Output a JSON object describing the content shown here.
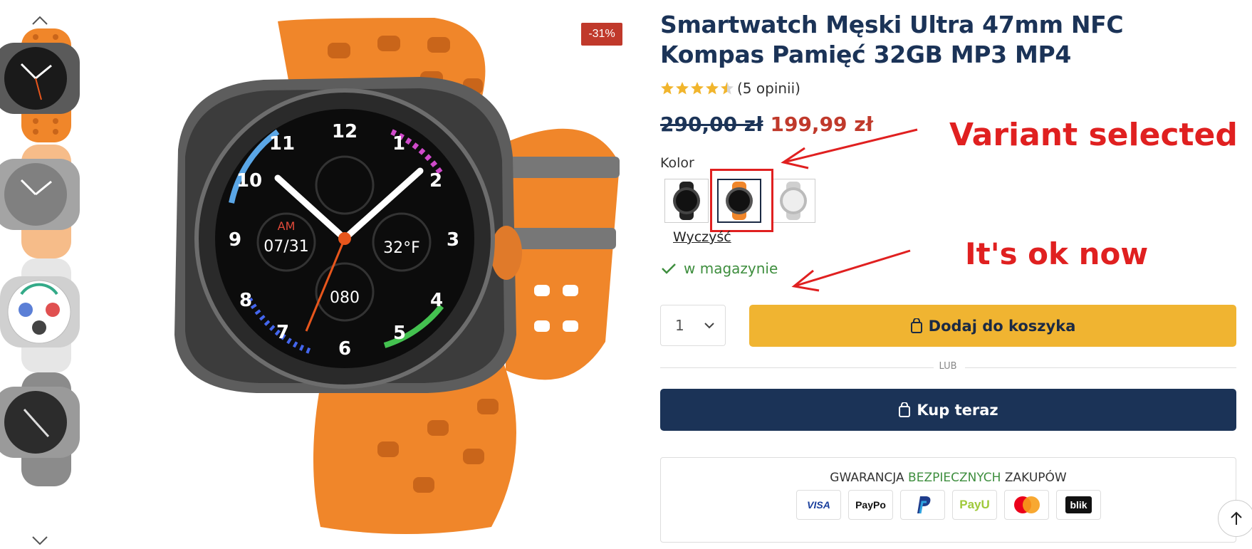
{
  "gallery": {
    "thumbnails": [
      "orange-band-watch",
      "orange-band-watch-alt",
      "white-watch",
      "grey-watch"
    ]
  },
  "product": {
    "discount_badge": "-31%",
    "title": "Smartwatch Męski Ultra 47mm NFC Kompas Pamięć 32GB MP3 MP4",
    "rating": 4.5,
    "reviews_text": "(5 opinii)",
    "old_price": "290,00 zł",
    "new_price": "199,99 zł",
    "color_label": "Kolor",
    "variants": [
      "black",
      "orange",
      "silver"
    ],
    "selected_variant": "orange",
    "clear_label": "Wyczyść",
    "stock_text": "w magazynie",
    "quantity": "1",
    "add_to_cart_label": "Dodaj do koszyka",
    "or_label": "LUB",
    "buy_now_label": "Kup teraz",
    "guarantee": {
      "part1": "GWARANCJA ",
      "part2": "BEZPIECZNYCH",
      "part3": " ZAKUPÓW"
    },
    "payments": [
      "VISA",
      "PayPo",
      "PayPal",
      "PayU",
      "Mastercard",
      "blik"
    ]
  },
  "annotations": {
    "variant_note": "Variant selected",
    "ok_note": "It's ok now"
  },
  "colors": {
    "accent_yellow": "#f0b431",
    "navy": "#1b3357",
    "sale_red": "#c0392b",
    "stock_green": "#3e8e3e",
    "annotation_red": "#e02020"
  }
}
